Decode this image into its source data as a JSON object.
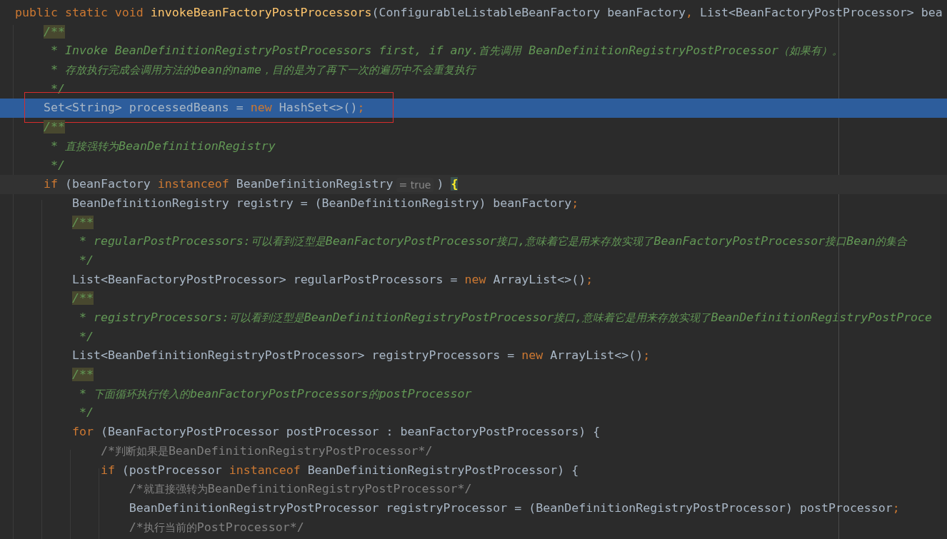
{
  "editor": {
    "lines": [
      {
        "selected": false,
        "current": false,
        "boxed": false,
        "segments": [
          {
            "kind": "kw",
            "text": "public static void "
          },
          {
            "kind": "fn",
            "text": "invokeBeanFactoryPostProcessors"
          },
          {
            "kind": "plain",
            "text": "(ConfigurableListableBeanFactory beanFactory"
          },
          {
            "kind": "punct",
            "text": ","
          },
          {
            "kind": "plain",
            "text": " List<BeanFactoryPostProcessor> bea"
          }
        ]
      },
      {
        "selected": false,
        "current": false,
        "boxed": false,
        "segments": [
          {
            "kind": "doc-open",
            "text": "    /**"
          }
        ]
      },
      {
        "selected": false,
        "current": false,
        "boxed": false,
        "segments": [
          {
            "kind": "doc",
            "text": "     * Invoke BeanDefinitionRegistryPostProcessors first, if any.首先调用 BeanDefinitionRegistryPostProcessor（如果有）。"
          }
        ]
      },
      {
        "selected": false,
        "current": false,
        "boxed": false,
        "segments": [
          {
            "kind": "doc",
            "text": "     * 存放执行完成会调用方法的bean的name，目的是为了再下一次的遍历中不会重复执行"
          }
        ]
      },
      {
        "selected": false,
        "current": false,
        "boxed": false,
        "segments": [
          {
            "kind": "doc",
            "text": "     */"
          }
        ]
      },
      {
        "selected": true,
        "current": false,
        "boxed": true,
        "segments": [
          {
            "kind": "plain",
            "text": "    Set<String> processedBeans = "
          },
          {
            "kind": "kw",
            "text": "new"
          },
          {
            "kind": "plain",
            "text": " HashSet<>()"
          },
          {
            "kind": "punct",
            "text": ";"
          }
        ]
      },
      {
        "selected": false,
        "current": false,
        "boxed": false,
        "segments": [
          {
            "kind": "doc-open",
            "text": "    /**"
          }
        ]
      },
      {
        "selected": false,
        "current": false,
        "boxed": false,
        "segments": [
          {
            "kind": "doc",
            "text": "     * 直接强转为BeanDefinitionRegistry"
          }
        ]
      },
      {
        "selected": false,
        "current": false,
        "boxed": false,
        "segments": [
          {
            "kind": "doc",
            "text": "     */"
          }
        ]
      },
      {
        "selected": false,
        "current": true,
        "boxed": false,
        "segments": [
          {
            "kind": "kw",
            "text": "    if"
          },
          {
            "kind": "plain",
            "text": " (beanFactory "
          },
          {
            "kind": "kw",
            "text": "instanceof"
          },
          {
            "kind": "plain",
            "text": " BeanDefinitionRegistry"
          },
          {
            "kind": "hint",
            "text": "= true"
          },
          {
            "kind": "plain",
            "text": ") "
          },
          {
            "kind": "brace",
            "text": "{"
          }
        ]
      },
      {
        "selected": false,
        "current": false,
        "boxed": false,
        "segments": [
          {
            "kind": "plain",
            "text": "        BeanDefinitionRegistry registry = (BeanDefinitionRegistry) beanFactory"
          },
          {
            "kind": "punct",
            "text": ";"
          }
        ]
      },
      {
        "selected": false,
        "current": false,
        "boxed": false,
        "segments": [
          {
            "kind": "doc-open",
            "text": "        /**"
          }
        ]
      },
      {
        "selected": false,
        "current": false,
        "boxed": false,
        "segments": [
          {
            "kind": "doc",
            "text": "         * regularPostProcessors:可以看到泛型是BeanFactoryPostProcessor接口,意味着它是用来存放实现了BeanFactoryPostProcessor接口Bean的集合"
          }
        ]
      },
      {
        "selected": false,
        "current": false,
        "boxed": false,
        "segments": [
          {
            "kind": "doc",
            "text": "         */"
          }
        ]
      },
      {
        "selected": false,
        "current": false,
        "boxed": false,
        "segments": [
          {
            "kind": "plain",
            "text": "        List<BeanFactoryPostProcessor> regularPostProcessors = "
          },
          {
            "kind": "kw",
            "text": "new"
          },
          {
            "kind": "plain",
            "text": " ArrayList<>()"
          },
          {
            "kind": "punct",
            "text": ";"
          }
        ]
      },
      {
        "selected": false,
        "current": false,
        "boxed": false,
        "segments": [
          {
            "kind": "doc-open",
            "text": "        /**"
          }
        ]
      },
      {
        "selected": false,
        "current": false,
        "boxed": false,
        "segments": [
          {
            "kind": "doc",
            "text": "         * registryProcessors:可以看到泛型是BeanDefinitionRegistryPostProcessor接口,意味着它是用来存放实现了BeanDefinitionRegistryPostProce"
          }
        ]
      },
      {
        "selected": false,
        "current": false,
        "boxed": false,
        "segments": [
          {
            "kind": "doc",
            "text": "         */"
          }
        ]
      },
      {
        "selected": false,
        "current": false,
        "boxed": false,
        "segments": [
          {
            "kind": "plain",
            "text": "        List<BeanDefinitionRegistryPostProcessor> registryProcessors = "
          },
          {
            "kind": "kw",
            "text": "new"
          },
          {
            "kind": "plain",
            "text": " ArrayList<>()"
          },
          {
            "kind": "punct",
            "text": ";"
          }
        ]
      },
      {
        "selected": false,
        "current": false,
        "boxed": false,
        "segments": [
          {
            "kind": "doc-open",
            "text": "        /**"
          }
        ]
      },
      {
        "selected": false,
        "current": false,
        "boxed": false,
        "segments": [
          {
            "kind": "doc",
            "text": "         * 下面循环执行传入的beanFactoryPostProcessors的postProcessor"
          }
        ]
      },
      {
        "selected": false,
        "current": false,
        "boxed": false,
        "segments": [
          {
            "kind": "doc",
            "text": "         */"
          }
        ]
      },
      {
        "selected": false,
        "current": false,
        "boxed": false,
        "segments": [
          {
            "kind": "kw",
            "text": "        for"
          },
          {
            "kind": "plain",
            "text": " (BeanFactoryPostProcessor postProcessor : beanFactoryPostProcessors) {"
          }
        ]
      },
      {
        "selected": false,
        "current": false,
        "boxed": false,
        "segments": [
          {
            "kind": "cmt",
            "text": "            /*判断如果是BeanDefinitionRegistryPostProcessor*/"
          }
        ]
      },
      {
        "selected": false,
        "current": false,
        "boxed": false,
        "segments": [
          {
            "kind": "kw",
            "text": "            if"
          },
          {
            "kind": "plain",
            "text": " (postProcessor "
          },
          {
            "kind": "kw",
            "text": "instanceof"
          },
          {
            "kind": "plain",
            "text": " BeanDefinitionRegistryPostProcessor) {"
          }
        ]
      },
      {
        "selected": false,
        "current": false,
        "boxed": false,
        "segments": [
          {
            "kind": "cmt",
            "text": "                /*就直接强转为BeanDefinitionRegistryPostProcessor*/"
          }
        ]
      },
      {
        "selected": false,
        "current": false,
        "boxed": false,
        "segments": [
          {
            "kind": "plain",
            "text": "                BeanDefinitionRegistryPostProcessor registryProcessor = (BeanDefinitionRegistryPostProcessor) postProcessor"
          },
          {
            "kind": "punct",
            "text": ";"
          }
        ]
      },
      {
        "selected": false,
        "current": false,
        "boxed": false,
        "segments": [
          {
            "kind": "cmt",
            "text": "                /*执行当前的PostProcessor*/"
          }
        ]
      }
    ]
  }
}
